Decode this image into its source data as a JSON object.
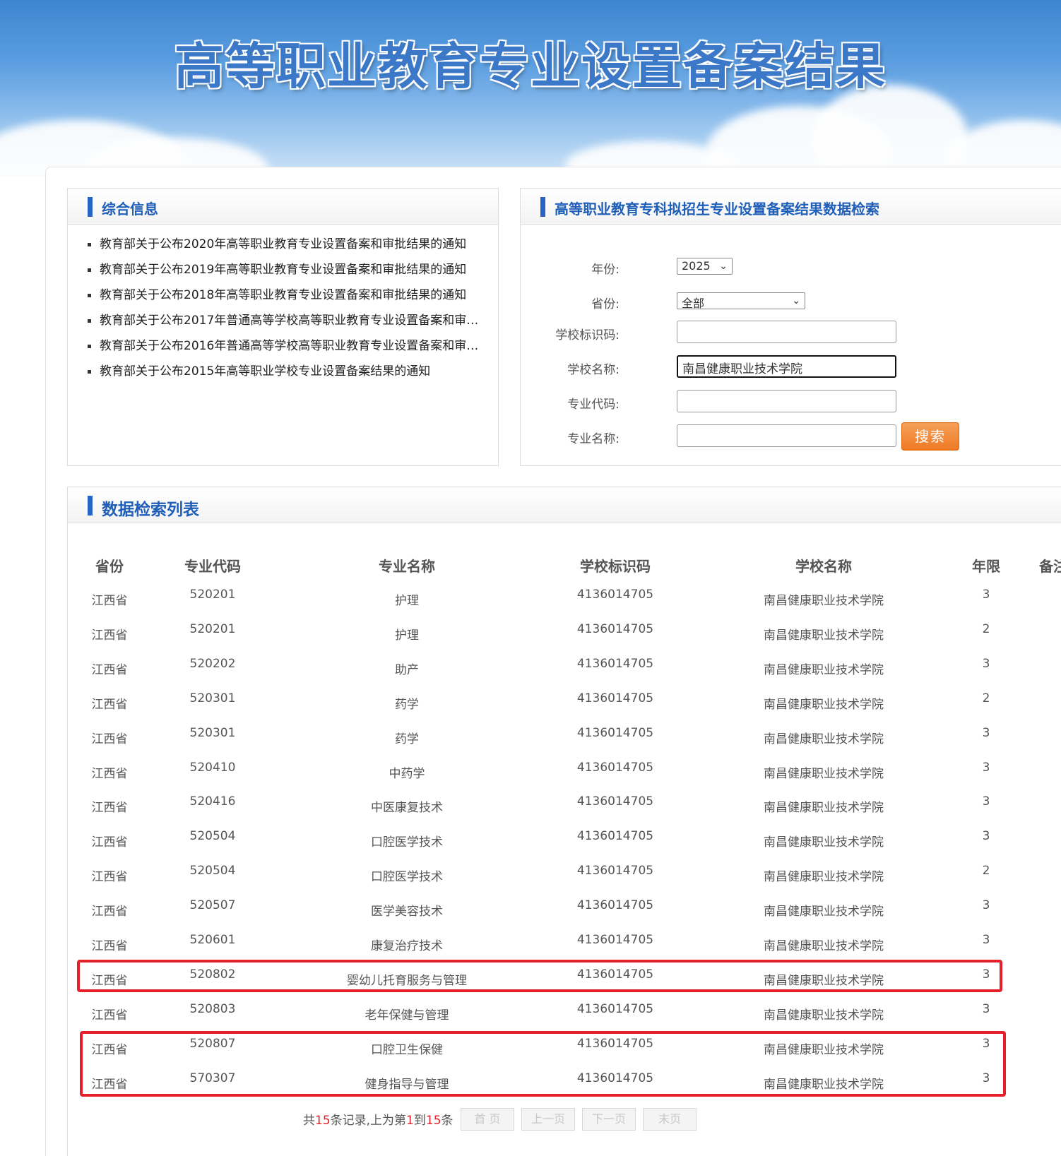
{
  "banner": {
    "title": "高等职业教育专业设置备案结果"
  },
  "info_panel": {
    "title": "综合信息",
    "items": [
      "教育部关于公布2020年高等职业教育专业设置备案和审批结果的通知",
      "教育部关于公布2019年高等职业教育专业设置备案和审批结果的通知",
      "教育部关于公布2018年高等职业教育专业设置备案和审批结果的通知",
      "教育部关于公布2017年普通高等学校高等职业教育专业设置备案和审…",
      "教育部关于公布2016年普通高等学校高等职业教育专业设置备案和审…",
      "教育部关于公布2015年高等职业学校专业设置备案结果的通知"
    ]
  },
  "search_panel": {
    "title": "高等职业教育专科拟招生专业设置备案结果数据检索",
    "year_label": "年份:",
    "year_value": "2025",
    "province_label": "省份:",
    "province_value": "全部",
    "school_id_label": "学校标识码:",
    "school_id_value": "",
    "school_name_label": "学校名称:",
    "school_name_value": "南昌健康职业技术学院",
    "major_code_label": "专业代码:",
    "major_code_value": "",
    "major_name_label": "专业名称:",
    "major_name_value": "",
    "search_button": "搜索"
  },
  "results": {
    "title": "数据检索列表",
    "headers": [
      "省份",
      "专业代码",
      "专业名称",
      "学校标识码",
      "学校名称",
      "年限",
      "备注"
    ],
    "rows": [
      [
        "江西省",
        "520201",
        "护理",
        "4136014705",
        "南昌健康职业技术学院",
        "3"
      ],
      [
        "江西省",
        "520201",
        "护理",
        "4136014705",
        "南昌健康职业技术学院",
        "2"
      ],
      [
        "江西省",
        "520202",
        "助产",
        "4136014705",
        "南昌健康职业技术学院",
        "3"
      ],
      [
        "江西省",
        "520301",
        "药学",
        "4136014705",
        "南昌健康职业技术学院",
        "2"
      ],
      [
        "江西省",
        "520301",
        "药学",
        "4136014705",
        "南昌健康职业技术学院",
        "3"
      ],
      [
        "江西省",
        "520410",
        "中药学",
        "4136014705",
        "南昌健康职业技术学院",
        "3"
      ],
      [
        "江西省",
        "520416",
        "中医康复技术",
        "4136014705",
        "南昌健康职业技术学院",
        "3"
      ],
      [
        "江西省",
        "520504",
        "口腔医学技术",
        "4136014705",
        "南昌健康职业技术学院",
        "3"
      ],
      [
        "江西省",
        "520504",
        "口腔医学技术",
        "4136014705",
        "南昌健康职业技术学院",
        "2"
      ],
      [
        "江西省",
        "520507",
        "医学美容技术",
        "4136014705",
        "南昌健康职业技术学院",
        "3"
      ],
      [
        "江西省",
        "520601",
        "康复治疗技术",
        "4136014705",
        "南昌健康职业技术学院",
        "3"
      ],
      [
        "江西省",
        "520802",
        "婴幼儿托育服务与管理",
        "4136014705",
        "南昌健康职业技术学院",
        "3"
      ],
      [
        "江西省",
        "520803",
        "老年保健与管理",
        "4136014705",
        "南昌健康职业技术学院",
        "3"
      ],
      [
        "江西省",
        "520807",
        "口腔卫生保健",
        "4136014705",
        "南昌健康职业技术学院",
        "3"
      ],
      [
        "江西省",
        "570307",
        "健身指导与管理",
        "4136014705",
        "南昌健康职业技术学院",
        "3"
      ]
    ]
  },
  "pager": {
    "text_1": "共",
    "total": "15",
    "text_2": "条记录,上为第",
    "from": "1",
    "text_3": "到",
    "to": "15",
    "text_4": "条",
    "first": "首 页",
    "prev": "上一页",
    "next": "下一页",
    "last": "末页"
  },
  "colors": {
    "accent_blue": "#2a63c6",
    "highlight_red": "#e5202a",
    "search_orange": "#ef7a24"
  }
}
